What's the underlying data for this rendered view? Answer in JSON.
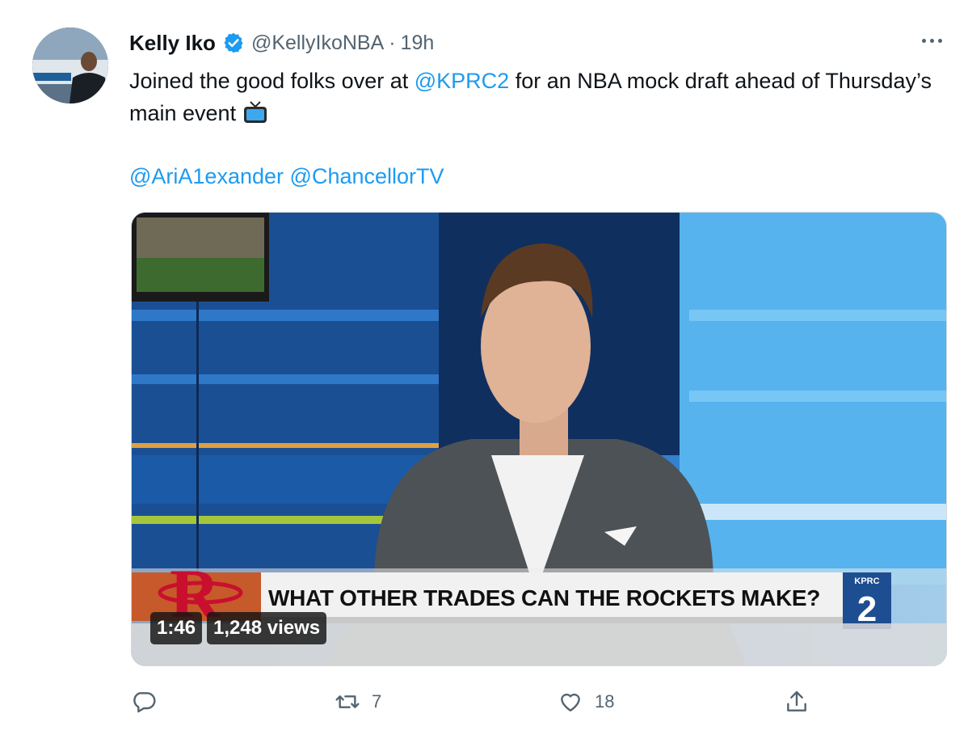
{
  "author": {
    "display_name": "Kelly Iko",
    "handle": "@KellyIkoNBA",
    "separator": "·",
    "time": "19h"
  },
  "tweet": {
    "text_part1": "Joined the good folks over at ",
    "mention1": "@KPRC2",
    "text_part2": " for an NBA mock draft ahead of Thursday’s main event",
    "mention2": "@AriA1exander",
    "mention3": "@ChancellorTV"
  },
  "video": {
    "chyron": "WHAT OTHER TRADES CAN THE ROCKETS MAKE?",
    "duration": "1:46",
    "views": "1,248 views",
    "station_logo_text": "KPRC",
    "station_number": "2"
  },
  "actions": {
    "replies": "",
    "retweets": "7",
    "likes": "18"
  },
  "icons": [
    "verified-icon",
    "more-icon",
    "tv-emoji-icon",
    "reply-icon",
    "retweet-icon",
    "like-icon",
    "share-icon"
  ],
  "colors": {
    "accent": "#1d9bf0",
    "text": "#0f1419",
    "secondary": "#536471"
  }
}
